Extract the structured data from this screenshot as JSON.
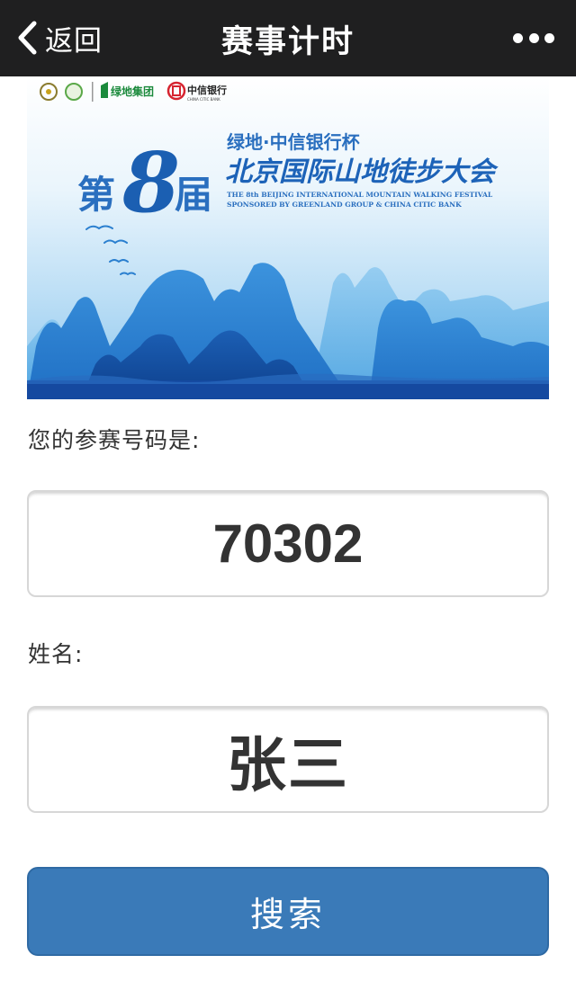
{
  "nav": {
    "back_label": "返回",
    "title": "赛事计时"
  },
  "banner": {
    "sponsor_greenland": "绿地集团",
    "sponsor_citic": "中信银行",
    "citic_en": "CHINA CITIC BANK",
    "cup_name": "绿地·中信银行杯",
    "edition_di": "第",
    "edition_num": "8",
    "edition_jie": "届",
    "event_name": "北京国际山地徒步大会",
    "en_line1": "THE 8th BEIJING INTERNATIONAL MOUNTAIN WALKING FESTIVAL",
    "en_line2": "SPONSORED BY GREENLAND GROUP & CHINA CITIC BANK"
  },
  "form": {
    "bib_label": "您的参赛号码是:",
    "bib_value": "70302",
    "name_label": "姓名:",
    "name_value": "张三",
    "search_label": "搜索"
  },
  "colors": {
    "nav_bg": "#1f1f20",
    "button_bg": "#3a7ab8"
  }
}
